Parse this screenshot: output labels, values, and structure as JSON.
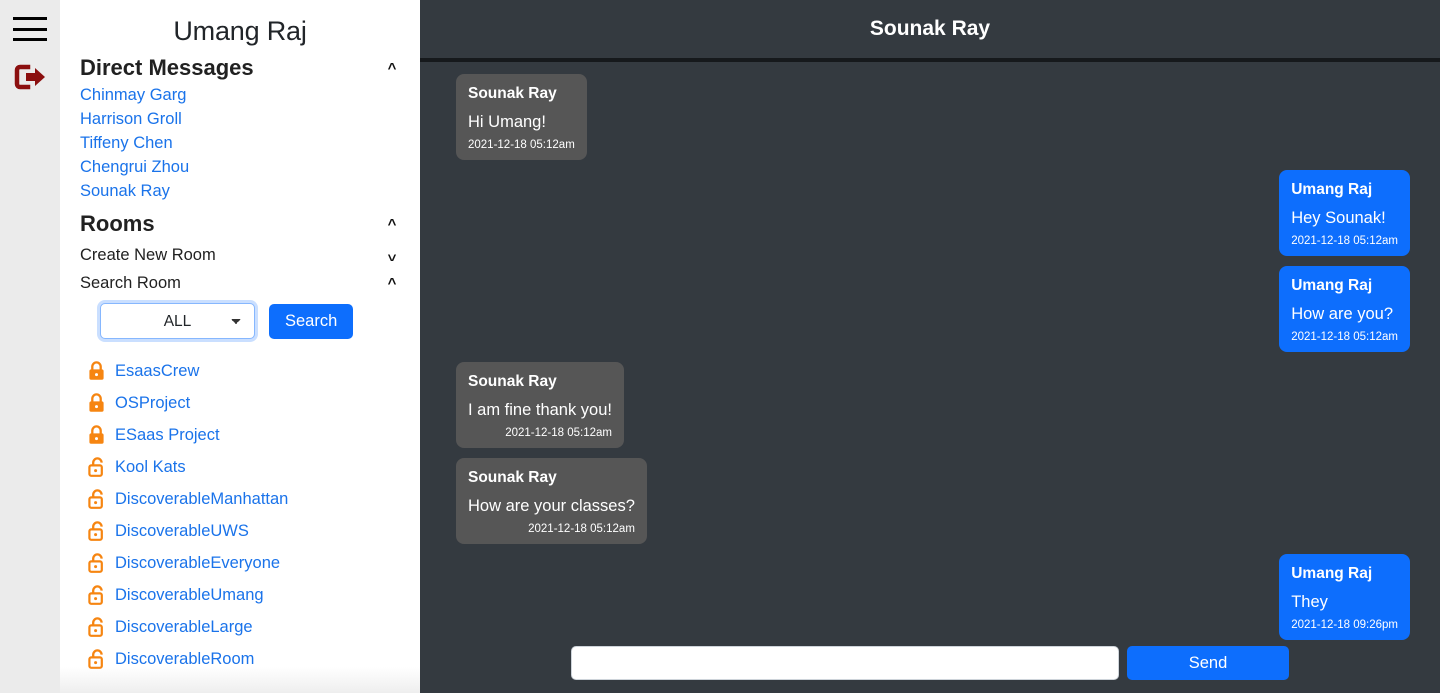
{
  "rail": {
    "menu_icon": "hamburger-menu-icon",
    "logout_icon": "logout-icon",
    "logout_color": "#8b0f0f"
  },
  "sidebar": {
    "user_name": "Umang Raj",
    "direct_messages": {
      "label": "Direct Messages",
      "chevron": "^",
      "items": [
        {
          "name": "Chinmay Garg"
        },
        {
          "name": "Harrison Groll"
        },
        {
          "name": "Tiffeny Chen"
        },
        {
          "name": "Chengrui Zhou"
        },
        {
          "name": "Sounak Ray"
        }
      ]
    },
    "rooms": {
      "label": "Rooms",
      "chevron": "^"
    },
    "create_room": {
      "label": "Create New Room",
      "chevron": "v"
    },
    "search_room": {
      "label": "Search Room",
      "chevron": "^",
      "select_value": "ALL",
      "select_options": [
        "ALL"
      ],
      "search_button": "Search"
    },
    "room_list": [
      {
        "name": "EsaasCrew",
        "lock": "locked-icon"
      },
      {
        "name": "OSProject",
        "lock": "locked-icon"
      },
      {
        "name": "ESaas Project",
        "lock": "locked-icon"
      },
      {
        "name": "Kool Kats",
        "lock": "unlocked-icon"
      },
      {
        "name": "DiscoverableManhattan",
        "lock": "unlocked-icon"
      },
      {
        "name": "DiscoverableUWS",
        "lock": "unlocked-icon"
      },
      {
        "name": "DiscoverableEveryone",
        "lock": "unlocked-icon"
      },
      {
        "name": "DiscoverableUmang",
        "lock": "unlocked-icon"
      },
      {
        "name": "DiscoverableLarge",
        "lock": "unlocked-icon"
      },
      {
        "name": "DiscoverableRoom",
        "lock": "unlocked-icon"
      }
    ],
    "link_color": "#1a73ea",
    "lock_color": "#f68511"
  },
  "chat": {
    "header_title": "Sounak Ray",
    "background": "#343a40",
    "them_bubble_color": "#565656",
    "me_bubble_color": "#0d6efd",
    "messages": [
      {
        "sender": "Sounak Ray",
        "text": "Hi Umang!",
        "time": "2021-12-18 05:12am",
        "side": "them"
      },
      {
        "sender": "Umang Raj",
        "text": "Hey Sounak!",
        "time": "2021-12-18 05:12am",
        "side": "me"
      },
      {
        "sender": "Umang Raj",
        "text": "How are you?",
        "time": "2021-12-18 05:12am",
        "side": "me"
      },
      {
        "sender": "Sounak Ray",
        "text": "I am fine thank you!",
        "time": "2021-12-18 05:12am",
        "side": "them"
      },
      {
        "sender": "Sounak Ray",
        "text": "How are your classes?",
        "time": "2021-12-18 05:12am",
        "side": "them"
      },
      {
        "sender": "Umang Raj",
        "text": "They",
        "time": "2021-12-18 09:26pm",
        "side": "me"
      }
    ],
    "composer": {
      "input_value": "",
      "input_placeholder": "",
      "send_label": "Send"
    }
  }
}
